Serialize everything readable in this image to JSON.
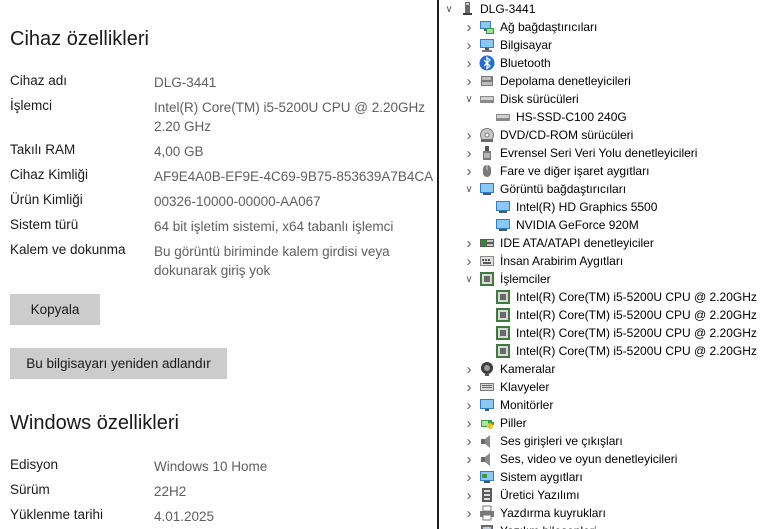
{
  "device_specs": {
    "title": "Cihaz özellikleri",
    "rows": [
      {
        "label": "Cihaz adı",
        "value": "DLG-3441"
      },
      {
        "label": "İşlemci",
        "value": "Intel(R) Core(TM) i5-5200U CPU @ 2.20GHz",
        "value2": "2.20 GHz"
      },
      {
        "label": "Takılı RAM",
        "value": "4,00 GB"
      },
      {
        "label": "Cihaz Kimliği",
        "value": "AF9E4A0B-EF9E-4C69-9B75-853639A7B4CA"
      },
      {
        "label": "Ürün Kimliği",
        "value": "00326-10000-00000-AA067"
      },
      {
        "label": "Sistem türü",
        "value": "64 bit işletim sistemi, x64 tabanlı işlemci"
      },
      {
        "label": "Kalem ve dokunma",
        "value": "Bu görüntü biriminde kalem girdisi veya",
        "value2": "dokunarak giriş yok"
      }
    ],
    "copy_button": "Kopyala",
    "rename_button": "Bu bilgisayarı yeniden adlandır"
  },
  "windows_specs": {
    "title": "Windows özellikleri",
    "rows": [
      {
        "label": "Edisyon",
        "value": "Windows 10 Home"
      },
      {
        "label": "Sürüm",
        "value": "22H2"
      },
      {
        "label": "Yüklenme tarihi",
        "value": "4.01.2025"
      }
    ]
  },
  "device_manager": {
    "root": {
      "label": "DLG-3441",
      "icon": "computer-icon"
    },
    "items": [
      {
        "label": "Ağ bağdaştırıcıları",
        "icon": "network-adapter-icon",
        "state": "collapsed",
        "level": 1
      },
      {
        "label": "Bilgisayar",
        "icon": "computer-icon",
        "state": "collapsed",
        "level": 1
      },
      {
        "label": "Bluetooth",
        "icon": "bluetooth-icon",
        "state": "collapsed",
        "level": 1
      },
      {
        "label": "Depolama denetleyicileri",
        "icon": "storage-controller-icon",
        "state": "collapsed",
        "level": 1
      },
      {
        "label": "Disk sürücüleri",
        "icon": "disk-drive-icon",
        "state": "expanded",
        "level": 1
      },
      {
        "label": "HS-SSD-C100 240G",
        "icon": "disk-drive-icon",
        "state": "leaf",
        "level": 2
      },
      {
        "label": "DVD/CD-ROM sürücüleri",
        "icon": "dvd-drive-icon",
        "state": "collapsed",
        "level": 1
      },
      {
        "label": "Evrensel Seri Veri Yolu denetleyicileri",
        "icon": "usb-icon",
        "state": "collapsed",
        "level": 1
      },
      {
        "label": "Fare ve diğer işaret aygıtları",
        "icon": "mouse-icon",
        "state": "collapsed",
        "level": 1
      },
      {
        "label": "Görüntü bağdaştırıcıları",
        "icon": "display-adapter-icon",
        "state": "expanded",
        "level": 1
      },
      {
        "label": "Intel(R) HD Graphics 5500",
        "icon": "display-adapter-icon",
        "state": "leaf",
        "level": 2
      },
      {
        "label": "NVIDIA GeForce 920M",
        "icon": "display-adapter-icon",
        "state": "leaf",
        "level": 2
      },
      {
        "label": "IDE ATA/ATAPI denetleyiciler",
        "icon": "ide-controller-icon",
        "state": "collapsed",
        "level": 1
      },
      {
        "label": "İnsan Arabirim Aygıtları",
        "icon": "hid-icon",
        "state": "collapsed",
        "level": 1
      },
      {
        "label": "İşlemciler",
        "icon": "processor-icon",
        "state": "expanded",
        "level": 1
      },
      {
        "label": "Intel(R) Core(TM) i5-5200U CPU @ 2.20GHz",
        "icon": "processor-icon",
        "state": "leaf",
        "level": 2
      },
      {
        "label": "Intel(R) Core(TM) i5-5200U CPU @ 2.20GHz",
        "icon": "processor-icon",
        "state": "leaf",
        "level": 2
      },
      {
        "label": "Intel(R) Core(TM) i5-5200U CPU @ 2.20GHz",
        "icon": "processor-icon",
        "state": "leaf",
        "level": 2
      },
      {
        "label": "Intel(R) Core(TM) i5-5200U CPU @ 2.20GHz",
        "icon": "processor-icon",
        "state": "leaf",
        "level": 2
      },
      {
        "label": "Kameralar",
        "icon": "camera-icon",
        "state": "collapsed",
        "level": 1
      },
      {
        "label": "Klavyeler",
        "icon": "keyboard-icon",
        "state": "collapsed",
        "level": 1
      },
      {
        "label": "Monitörler",
        "icon": "monitor-icon",
        "state": "collapsed",
        "level": 1
      },
      {
        "label": "Piller",
        "icon": "battery-icon",
        "state": "collapsed",
        "level": 1
      },
      {
        "label": "Ses girişleri ve çıkışları",
        "icon": "speaker-icon",
        "state": "collapsed",
        "level": 1
      },
      {
        "label": "Ses, video ve oyun denetleyicileri",
        "icon": "speaker-icon",
        "state": "collapsed",
        "level": 1
      },
      {
        "label": "Sistem aygıtları",
        "icon": "system-device-icon",
        "state": "collapsed",
        "level": 1
      },
      {
        "label": "Üretici Yazılımı",
        "icon": "firmware-icon",
        "state": "collapsed",
        "level": 1
      },
      {
        "label": "Yazdırma kuyrukları",
        "icon": "printer-icon",
        "state": "collapsed",
        "level": 1
      },
      {
        "label": "Yazılım bileşenleri",
        "icon": "software-component-icon",
        "state": "collapsed",
        "level": 1
      }
    ]
  }
}
